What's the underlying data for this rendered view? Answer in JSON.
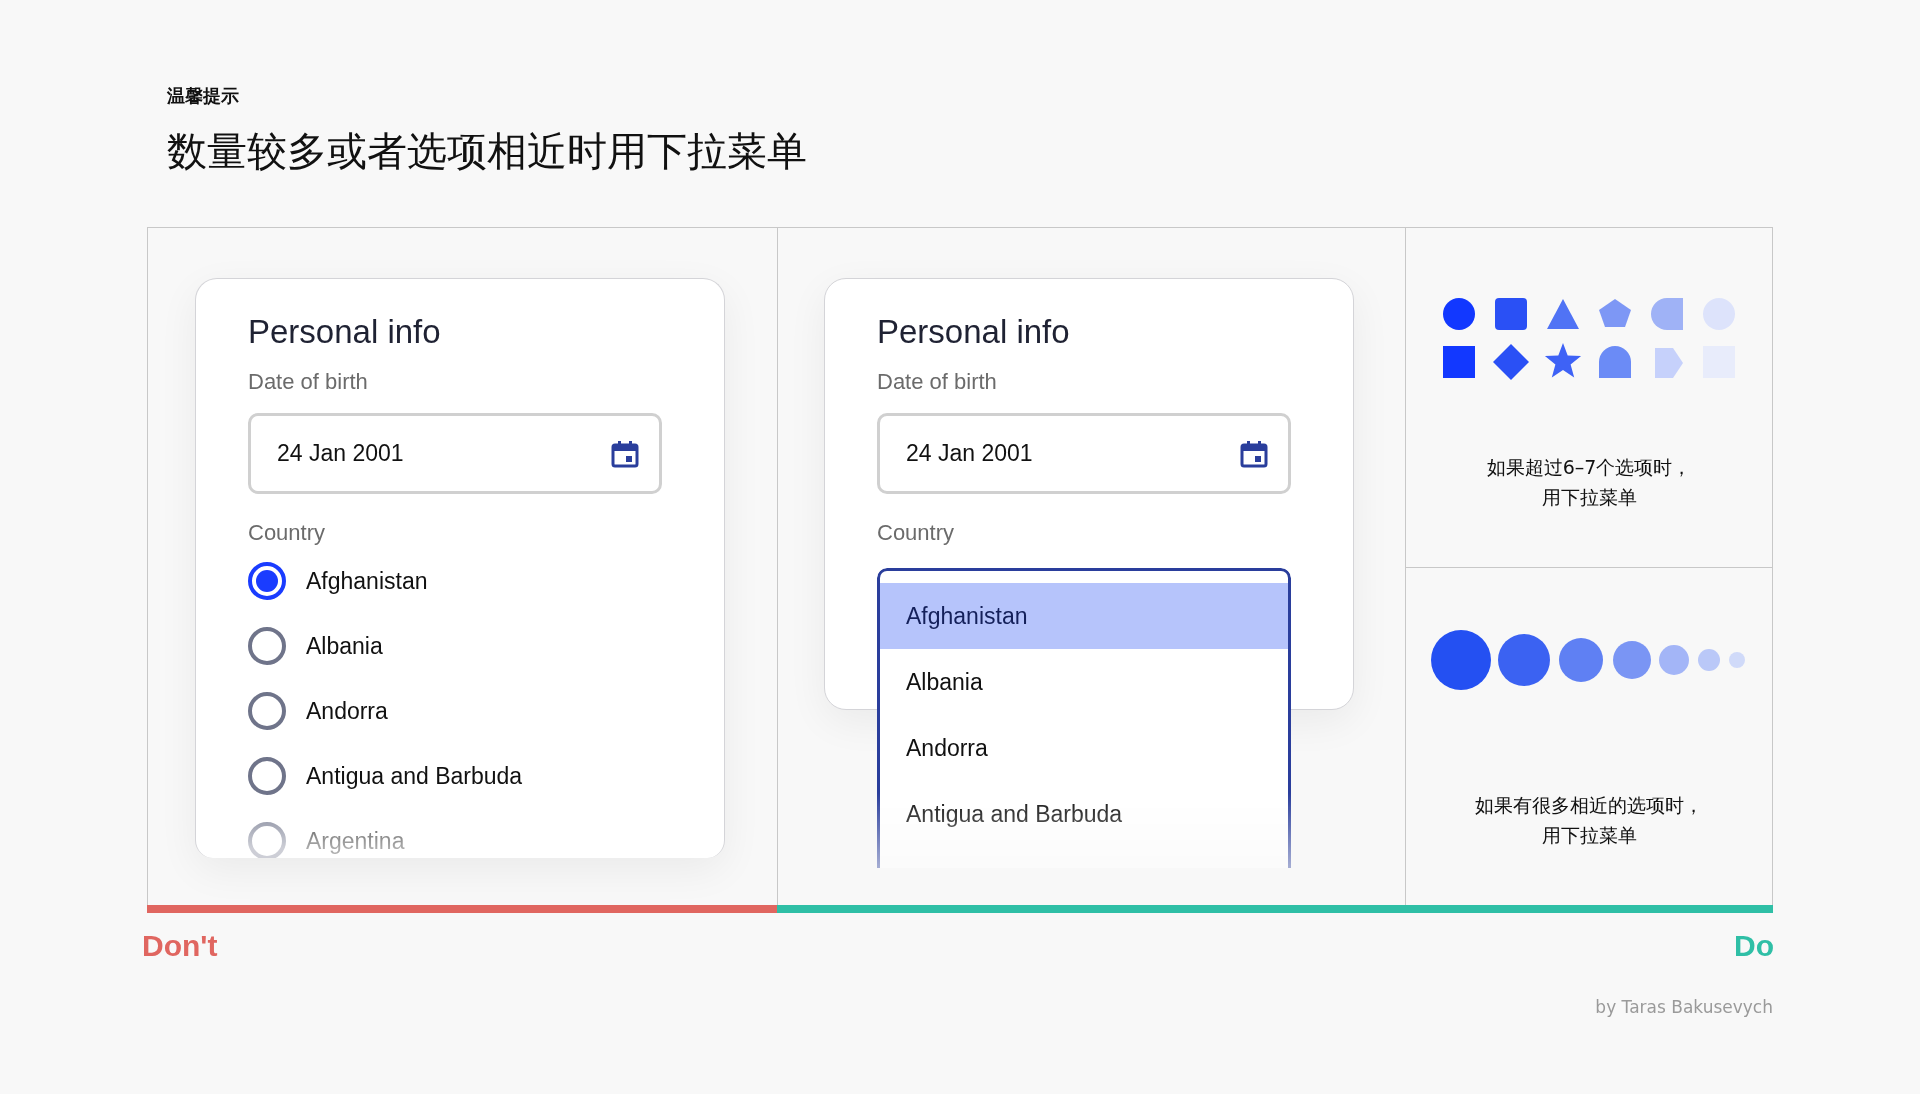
{
  "header": {
    "eyebrow": "温馨提示",
    "title": "数量较多或者选项相近时用下拉菜单"
  },
  "examples": [
    {
      "kind": "radio",
      "card_title": "Personal info",
      "date_label": "Date of birth",
      "date_value": "24 Jan 2001",
      "country_label": "Country",
      "options": [
        {
          "label": "Afghanistan",
          "selected": true
        },
        {
          "label": "Albania",
          "selected": false
        },
        {
          "label": "Andorra",
          "selected": false
        },
        {
          "label": "Antigua and Barbuda",
          "selected": false
        },
        {
          "label": "Argentina",
          "selected": false
        }
      ]
    },
    {
      "kind": "dropdown",
      "card_title": "Personal info",
      "date_label": "Date of birth",
      "date_value": "24 Jan 2001",
      "country_label": "Country",
      "options": [
        {
          "label": "Afghanistan",
          "selected": true
        },
        {
          "label": "Albania",
          "selected": false
        },
        {
          "label": "Andorra",
          "selected": false
        },
        {
          "label": "Antigua and Barbuda",
          "selected": false
        }
      ]
    }
  ],
  "notes": [
    {
      "kind": "shapes",
      "lines": [
        "如果超过6–7个选项时，",
        "用下拉菜单"
      ]
    },
    {
      "kind": "circles",
      "lines": [
        "如果有很多相近的选项时，",
        "用下拉菜单"
      ]
    }
  ],
  "verdicts": [
    {
      "kind": "dont",
      "label": "Don't"
    },
    {
      "kind": "do",
      "label": "Do"
    }
  ],
  "credit": "by Taras Bakusevych"
}
